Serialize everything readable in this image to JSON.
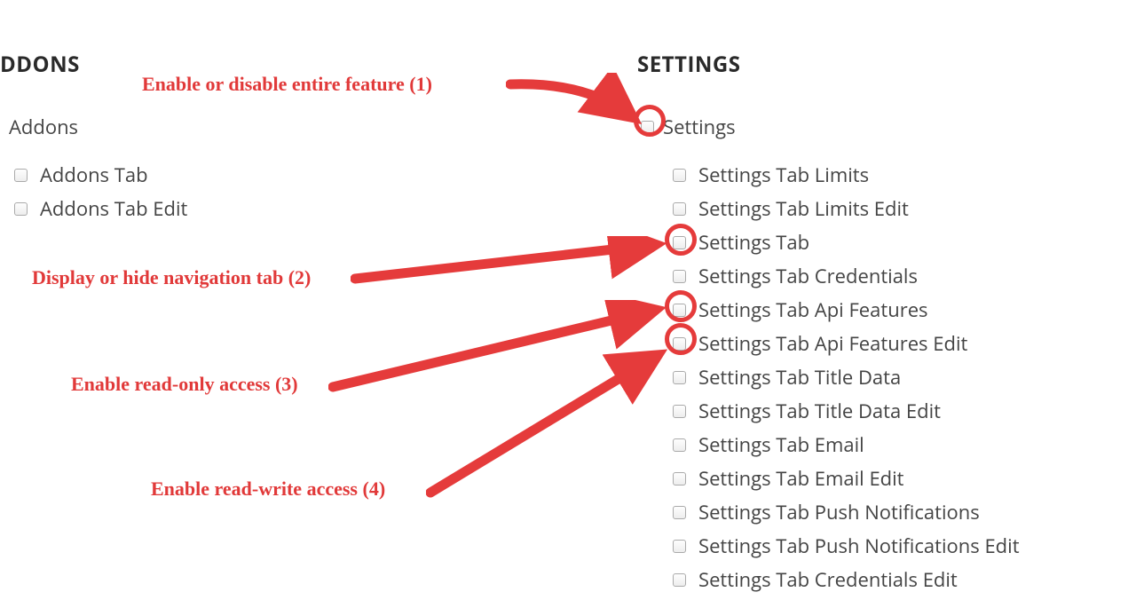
{
  "addons": {
    "heading": "DDONS",
    "parent_label": "Addons",
    "items": [
      {
        "label": "Addons Tab"
      },
      {
        "label": "Addons Tab Edit"
      }
    ]
  },
  "settings": {
    "heading": "SETTINGS",
    "parent_label": "Settings",
    "items": [
      {
        "label": "Settings Tab Limits"
      },
      {
        "label": "Settings Tab Limits Edit"
      },
      {
        "label": "Settings Tab"
      },
      {
        "label": "Settings Tab Credentials"
      },
      {
        "label": "Settings Tab Api Features"
      },
      {
        "label": "Settings Tab Api Features Edit"
      },
      {
        "label": "Settings Tab Title Data"
      },
      {
        "label": "Settings Tab Title Data Edit"
      },
      {
        "label": "Settings Tab Email"
      },
      {
        "label": "Settings Tab Email Edit"
      },
      {
        "label": "Settings Tab Push Notifications"
      },
      {
        "label": "Settings Tab Push Notifications Edit"
      },
      {
        "label": "Settings Tab Credentials Edit"
      }
    ]
  },
  "annotations": {
    "a1": "Enable or disable entire feature (1)",
    "a2": "Display or hide navigation tab (2)",
    "a3": "Enable read-only access (3)",
    "a4": "Enable read-write access (4)"
  },
  "colors": {
    "annotation_red": "#e53b3b"
  }
}
